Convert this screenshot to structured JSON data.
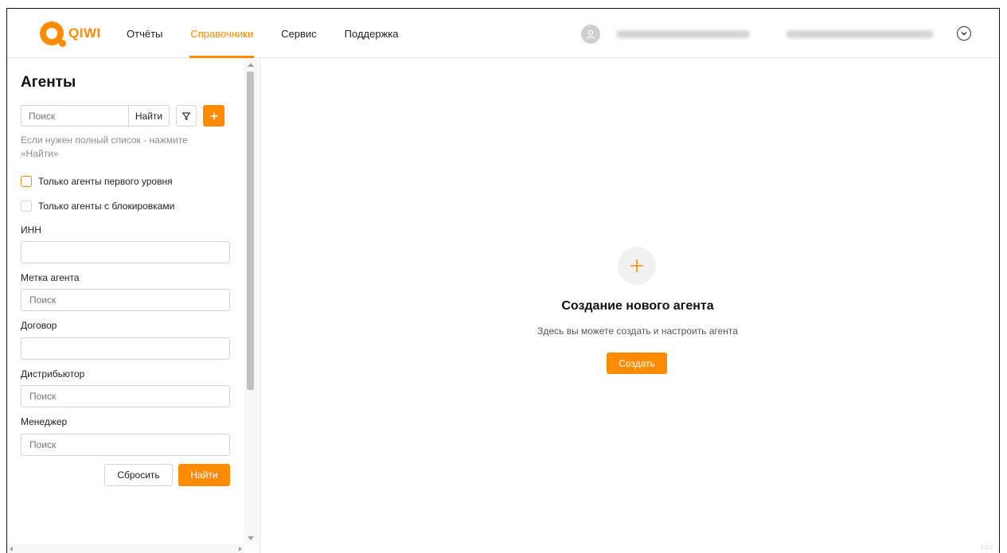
{
  "header": {
    "logo_text": "QIWI",
    "nav": [
      "Отчёты",
      "Справочники",
      "Сервис",
      "Поддержка"
    ],
    "active_nav": "Справочники"
  },
  "sidebar": {
    "title": "Агенты",
    "search_placeholder": "Поиск",
    "search_button": "Найти",
    "hint": "Если нужен полный список - нажмите «Найти»",
    "checkbox_first_level": "Только агенты первого уровня",
    "checkbox_blocked": "Только агенты с блокировками",
    "fields": {
      "inn_label": "ИНН",
      "inn_value": "",
      "tag_label": "Метка агента",
      "tag_placeholder": "Поиск",
      "contract_label": "Договор",
      "contract_value": "",
      "distributor_label": "Дистрибьютор",
      "distributor_placeholder": "Поиск",
      "manager_label": "Менеджер",
      "manager_placeholder": "Поиск"
    },
    "reset_button": "Сбросить",
    "find_button": "Найти"
  },
  "main": {
    "empty_title": "Создание нового агента",
    "empty_subtitle": "Здесь вы можете создать и настроить агента",
    "create_button": "Создать",
    "version": "2.2.0"
  },
  "colors": {
    "accent": "#ff8c00"
  }
}
